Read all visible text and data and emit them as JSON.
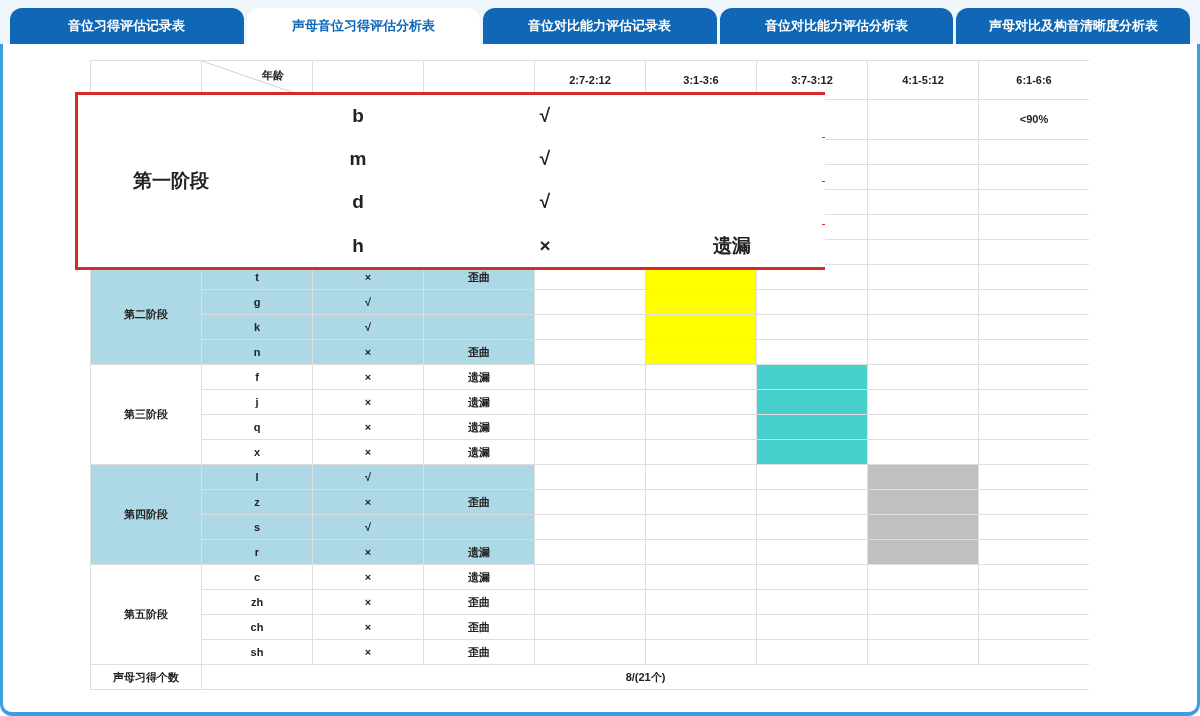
{
  "tabs": [
    {
      "label": "音位习得评估记录表",
      "selected": false
    },
    {
      "label": "声母音位习得评估分析表",
      "selected": true
    },
    {
      "label": "音位对比能力评估记录表",
      "selected": false
    },
    {
      "label": "音位对比能力评估分析表",
      "selected": false
    },
    {
      "label": "声母对比及构音清晰度分析表",
      "selected": false
    }
  ],
  "table": {
    "corner_label": "年龄",
    "age_columns": [
      "2:7-2:12",
      "3:1-3:6",
      "3:7-3:12",
      "4:1-5:12",
      "6:1-6:6"
    ],
    "stage_1_note": "<90%",
    "stages": [
      {
        "name": "第二阶段",
        "shaded": true,
        "color": "#ffff00",
        "rows": [
          {
            "consonant": "t",
            "result": "×",
            "error": "歪曲"
          },
          {
            "consonant": "g",
            "result": "√"
          },
          {
            "consonant": "k",
            "result": "√"
          },
          {
            "consonant": "n",
            "result": "×",
            "error": "歪曲"
          }
        ]
      },
      {
        "name": "第三阶段",
        "shaded": false,
        "color": "#48d1cc",
        "rows": [
          {
            "consonant": "f",
            "result": "×",
            "error": "遗漏"
          },
          {
            "consonant": "j",
            "result": "×",
            "error": "遗漏"
          },
          {
            "consonant": "q",
            "result": "×",
            "error": "遗漏"
          },
          {
            "consonant": "x",
            "result": "×",
            "error": "遗漏"
          }
        ]
      },
      {
        "name": "第四阶段",
        "shaded": true,
        "color": "#c0c0c0",
        "rows": [
          {
            "consonant": "l",
            "result": "√"
          },
          {
            "consonant": "z",
            "result": "×",
            "error": "歪曲"
          },
          {
            "consonant": "s",
            "result": "√"
          },
          {
            "consonant": "r",
            "result": "×",
            "error": "遗漏"
          }
        ]
      },
      {
        "name": "第五阶段",
        "shaded": false,
        "rows": [
          {
            "consonant": "c",
            "result": "×",
            "error": "遗漏"
          },
          {
            "consonant": "zh",
            "result": "×",
            "error": "歪曲"
          },
          {
            "consonant": "ch",
            "result": "×",
            "error": "歪曲"
          },
          {
            "consonant": "sh",
            "result": "×",
            "error": "歪曲"
          }
        ]
      }
    ],
    "summary": {
      "label": "声母习得个数",
      "value": "8/(21个)"
    }
  },
  "zoom_callout": {
    "stage": "第一阶段",
    "rows": [
      {
        "consonant": "b",
        "result": "√"
      },
      {
        "consonant": "m",
        "result": "√"
      },
      {
        "consonant": "d",
        "result": "√"
      },
      {
        "consonant": "h",
        "result": "×",
        "error": "遗漏"
      }
    ]
  }
}
